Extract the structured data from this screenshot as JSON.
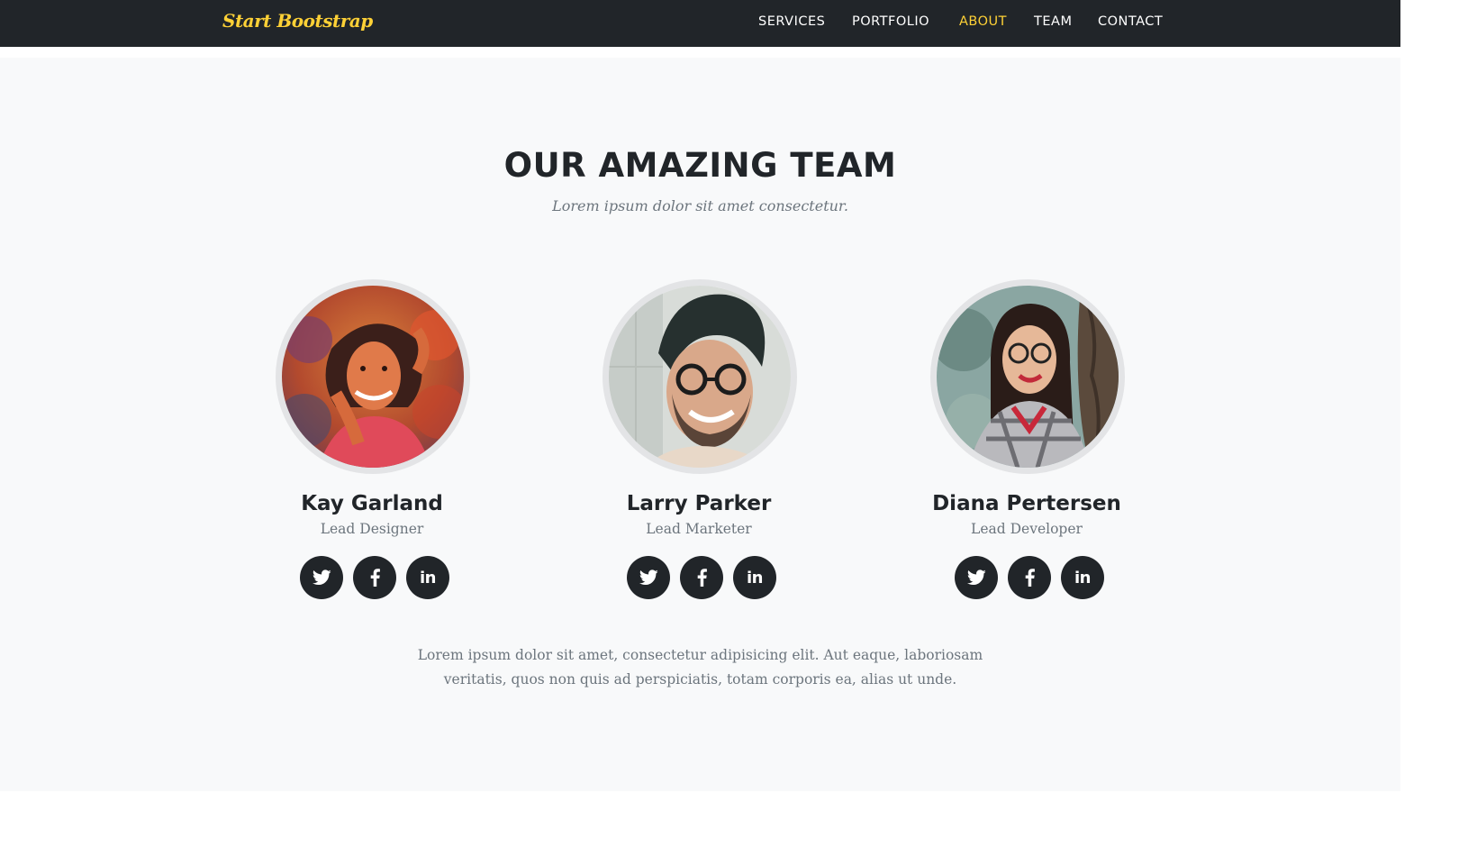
{
  "navbar": {
    "brand": "Start Bootstrap",
    "links": [
      {
        "label": "SERVICES",
        "active": false
      },
      {
        "label": "PORTFOLIO",
        "active": false
      },
      {
        "label": "ABOUT",
        "active": true
      },
      {
        "label": "TEAM",
        "active": false
      },
      {
        "label": "CONTACT",
        "active": false
      }
    ]
  },
  "team": {
    "heading": "OUR AMAZING TEAM",
    "subheading": "Lorem ipsum dolor sit amet consectetur.",
    "members": [
      {
        "name": "Kay Garland",
        "role": "Lead Designer",
        "socials": [
          "twitter-icon",
          "facebook-icon",
          "linkedin-icon"
        ]
      },
      {
        "name": "Larry Parker",
        "role": "Lead Marketer",
        "socials": [
          "twitter-icon",
          "facebook-icon",
          "linkedin-icon"
        ]
      },
      {
        "name": "Diana Pertersen",
        "role": "Lead Developer",
        "socials": [
          "twitter-icon",
          "facebook-icon",
          "linkedin-icon"
        ]
      }
    ],
    "linkedin_glyph": "in",
    "lead": "Lorem ipsum dolor sit amet, consectetur adipisicing elit. Aut eaque, laboriosam veritatis, quos non quis ad perspiciatis, totam corporis ea, alias ut unde."
  },
  "colors": {
    "navbar_bg": "#212529",
    "accent": "#fed136",
    "section_bg": "#f8f9fa",
    "heading": "#212529",
    "muted": "#6c757d",
    "social_bg": "#212529"
  }
}
